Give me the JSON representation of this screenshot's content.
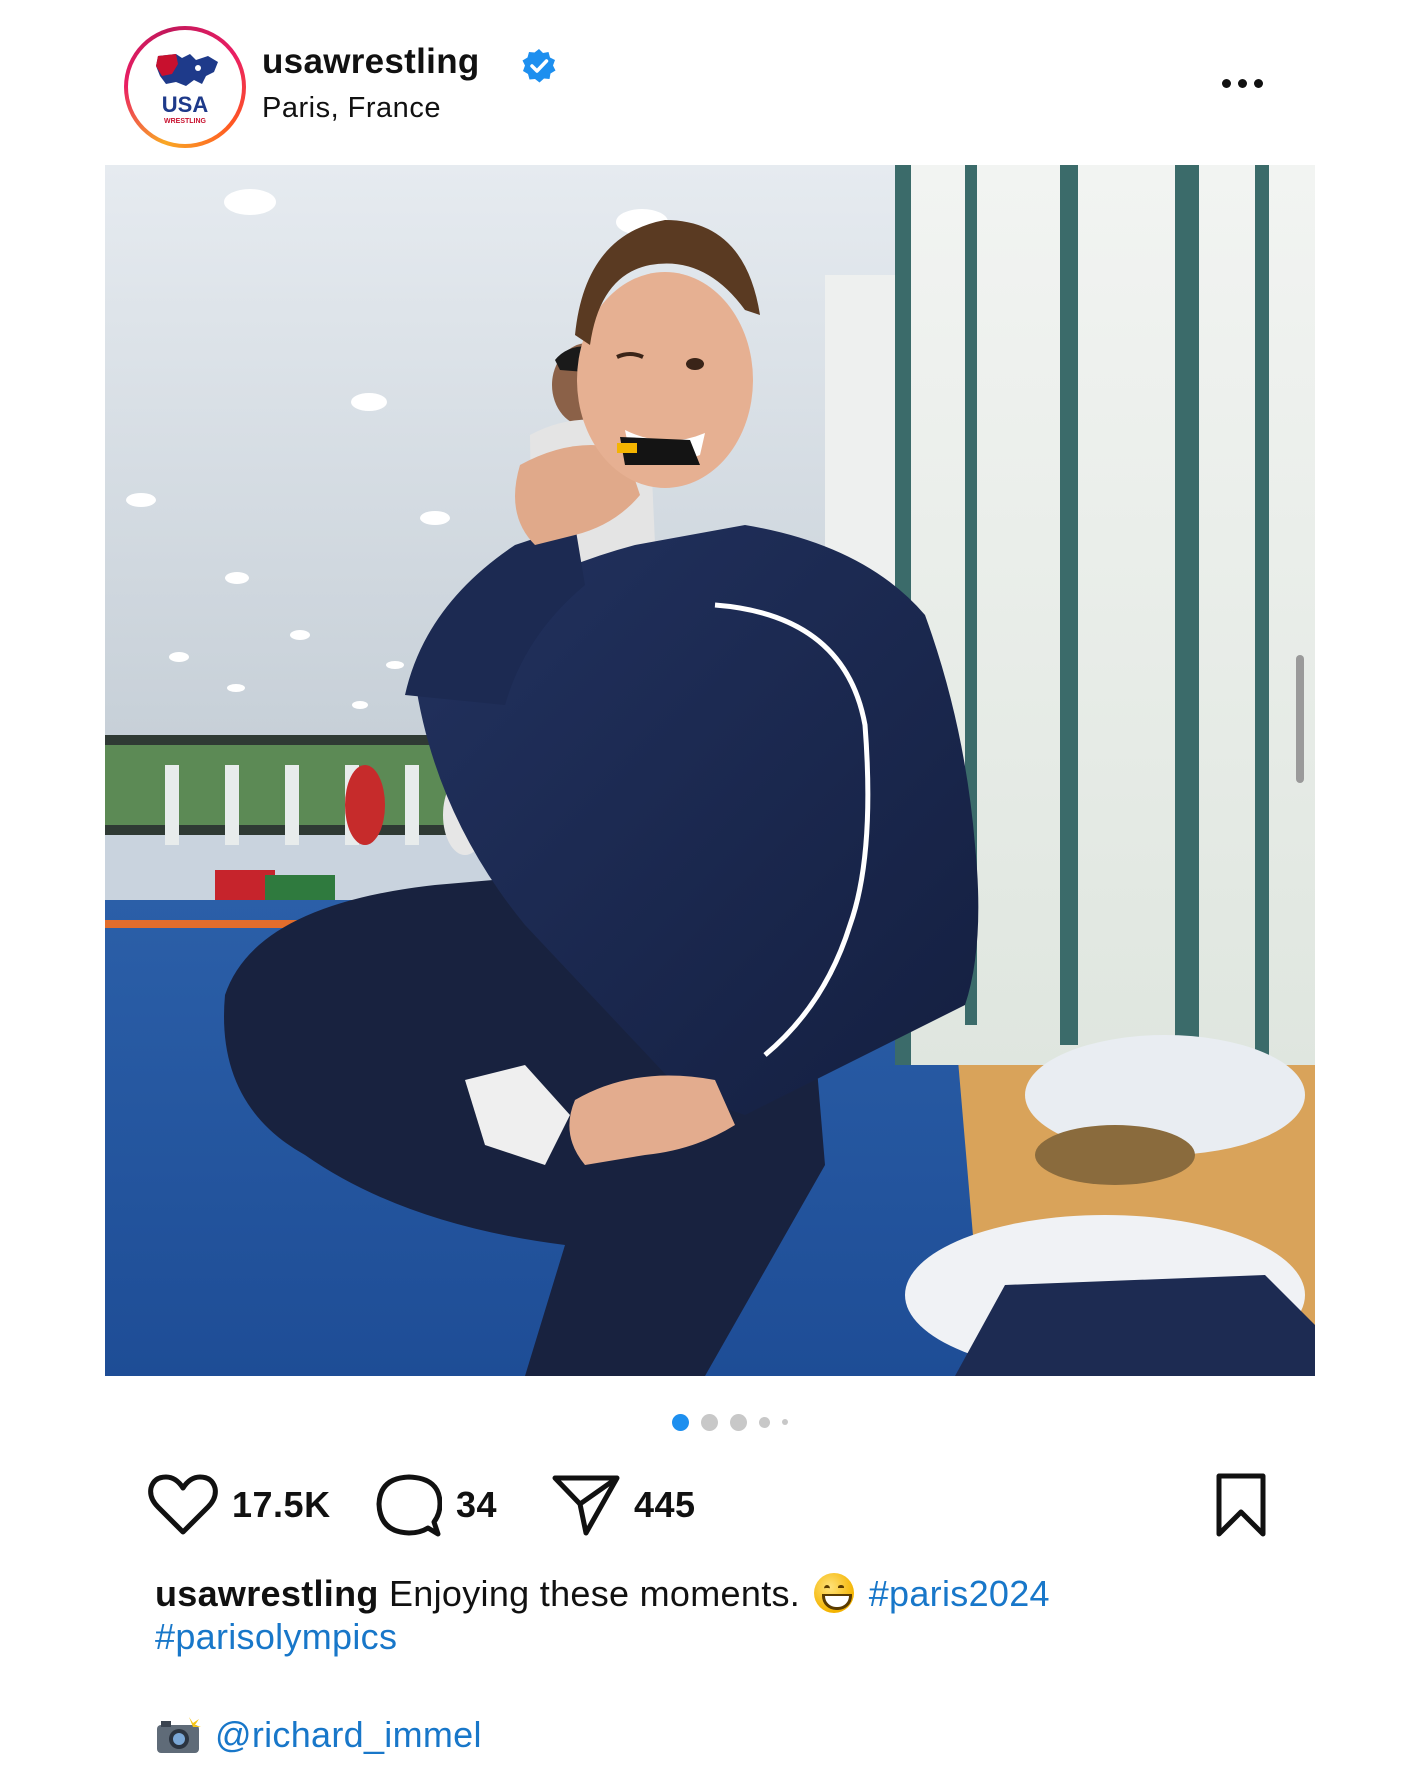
{
  "post": {
    "username": "usawrestling",
    "verified": true,
    "location": "Paris, France",
    "avatar": {
      "logo_text": "USA",
      "logo_subtext": "WRESTLING"
    },
    "image": {
      "description_icon": "photo"
    },
    "carousel": {
      "total_dots": 5,
      "active_index": 0
    },
    "stats": {
      "likes": "17.5K",
      "comments": "34",
      "shares": "445"
    },
    "caption": {
      "username": "usawrestling",
      "text": "Enjoying these moments.",
      "emoji": "grinning-face-icon",
      "hashtag_1": "#paris2024",
      "hashtag_2": "#parisolympics",
      "credit_icon": "camera-flash-icon",
      "credit_mention": "@richard_immel"
    }
  },
  "colors": {
    "link": "#1877c9",
    "active_dot": "#1d8fef",
    "verified_badge": "#1d8fef",
    "text": "#111111"
  }
}
